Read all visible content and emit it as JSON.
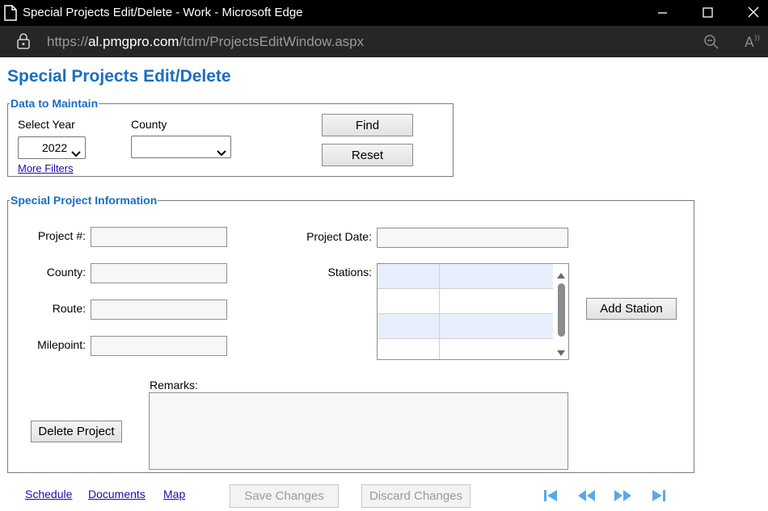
{
  "window": {
    "title": "Special Projects Edit/Delete - Work - Microsoft Edge",
    "url_prefix": "https://",
    "url_host": "al.pmgpro.com",
    "url_path": "/tdm/ProjectsEditWindow.aspx"
  },
  "page": {
    "title": "Special Projects Edit/Delete"
  },
  "maintain": {
    "legend": "Data to Maintain",
    "year_label": "Select Year",
    "year_value": "2022",
    "county_label": "County",
    "county_value": "",
    "more_filters": "More Filters",
    "find_label": "Find",
    "reset_label": "Reset"
  },
  "info": {
    "legend": "Special Project Information",
    "project_num_label": "Project #:",
    "county_label": "County:",
    "route_label": "Route:",
    "milepoint_label": "Milepoint:",
    "project_date_label": "Project Date:",
    "stations_label": "Stations:",
    "add_station_label": "Add Station",
    "remarks_label": "Remarks:",
    "delete_label": "Delete Project",
    "project_num_value": "",
    "county_value": "",
    "route_value": "",
    "milepoint_value": "",
    "project_date_value": "",
    "remarks_value": ""
  },
  "footer": {
    "links": [
      "Schedule",
      "Documents",
      "Map"
    ],
    "save_label": "Save Changes",
    "discard_label": "Discard Changes",
    "nav_icons": [
      "first-record-icon",
      "previous-record-icon",
      "next-record-icon",
      "last-record-icon"
    ]
  },
  "colors": {
    "accent": "#1a6ec3",
    "link": "#1a0dab",
    "nav_icon": "#5aa9e6",
    "grid_alt_row": "#e7effc"
  }
}
